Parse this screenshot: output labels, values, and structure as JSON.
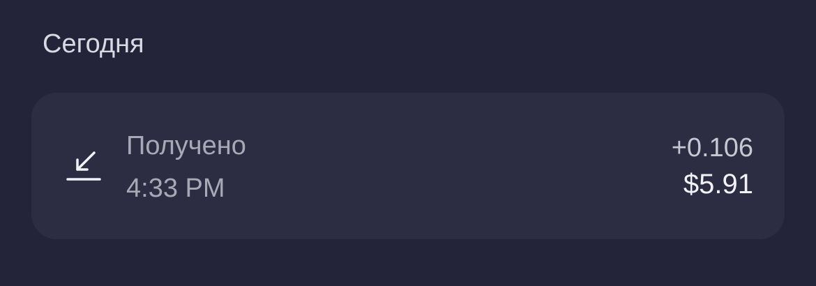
{
  "section": {
    "title": "Сегодня"
  },
  "transaction": {
    "icon": "arrow-down-left-icon",
    "type_label": "Получено",
    "time": "4:33 PM",
    "amount": "+0.106",
    "fiat_value": "$5.91"
  },
  "colors": {
    "background": "#23233a",
    "card": "#2c2c42",
    "primary_text": "#f2f2f6",
    "secondary_text": "#a9a9b6"
  }
}
